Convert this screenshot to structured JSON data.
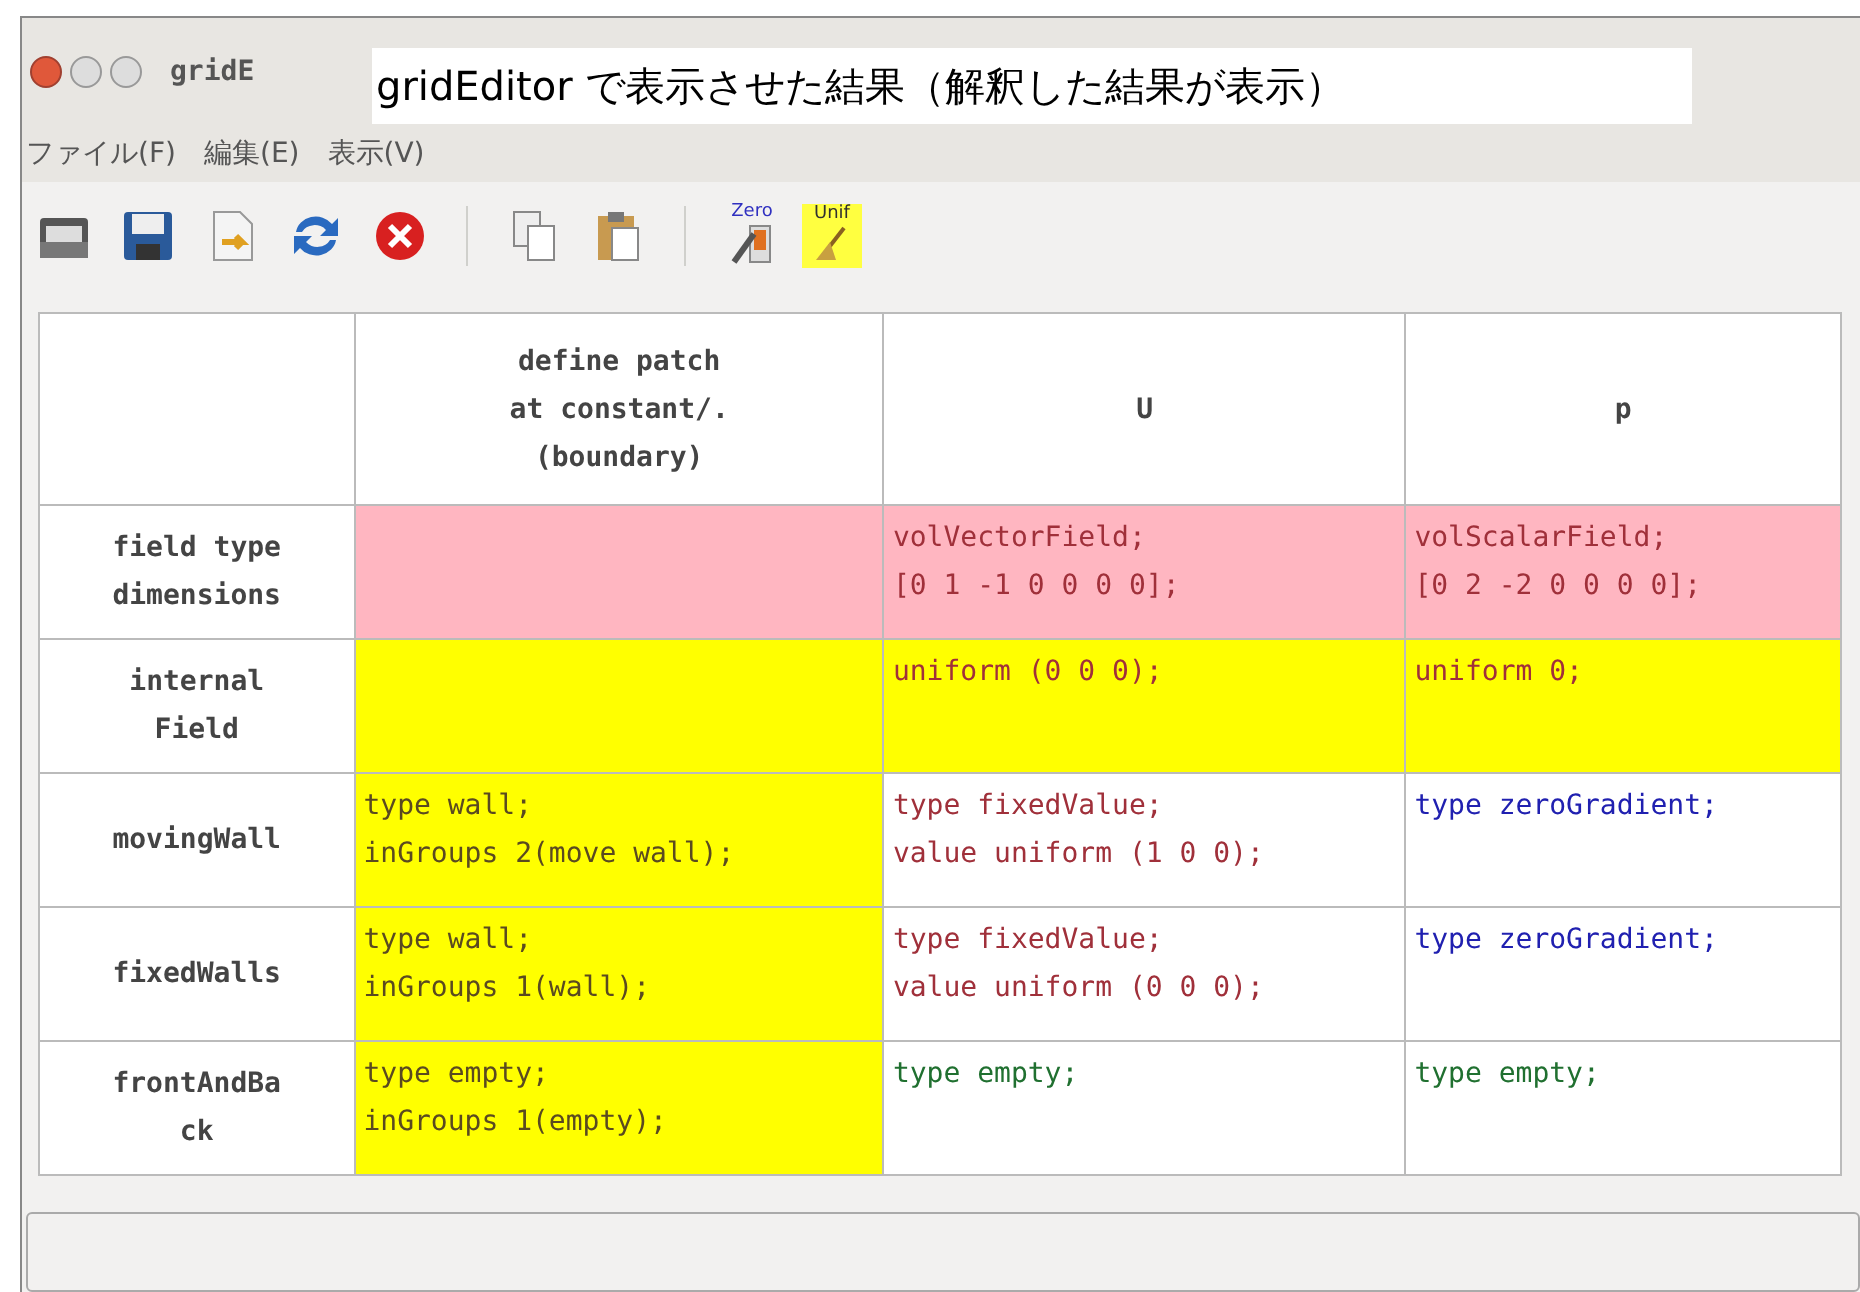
{
  "window": {
    "title": "gridE"
  },
  "caption": "gridEditor で表示させた結果（解釈した結果が表示）",
  "menu": [
    "ファイル(F)",
    "編集(E)",
    "表示(V)"
  ],
  "toolbar": [
    {
      "kind": "open"
    },
    {
      "kind": "save"
    },
    {
      "kind": "import"
    },
    {
      "kind": "refresh"
    },
    {
      "kind": "close"
    },
    {
      "kind": "separator"
    },
    {
      "kind": "copy"
    },
    {
      "kind": "paste"
    },
    {
      "kind": "separator"
    },
    {
      "kind": "zero",
      "label": "Zero"
    },
    {
      "kind": "unif",
      "label": "Unif"
    }
  ],
  "table": {
    "columns": [
      "",
      "define patch\nat constant/.\n(boundary)",
      "U",
      "p"
    ],
    "rows": [
      {
        "cells": [
          {
            "kind": "header",
            "lines": [
              "field type",
              "dimensions"
            ]
          },
          {
            "kind": "pink"
          },
          {
            "kind": "pink",
            "color": "#a0303a",
            "lines": [
              "volVectorField;",
              "[0 1 -1 0 0 0 0];"
            ]
          },
          {
            "kind": "pink",
            "color": "#a0303a",
            "lines": [
              "volScalarField;",
              "[0 2 -2 0 0 0 0];"
            ]
          }
        ]
      },
      {
        "cells": [
          {
            "kind": "header",
            "lines": [
              "internal",
              "Field"
            ]
          },
          {
            "kind": "yellow"
          },
          {
            "kind": "yellow",
            "color": "#a0303a",
            "lines": [
              "uniform (0 0 0);"
            ]
          },
          {
            "kind": "yellow",
            "color": "#a0303a",
            "lines": [
              "uniform 0;"
            ]
          }
        ]
      },
      {
        "cells": [
          {
            "kind": "header",
            "lines": [
              "movingWall"
            ]
          },
          {
            "kind": "yellow",
            "color": "#5a4a20",
            "lines": [
              "type wall;",
              "inGroups 2(move wall);"
            ]
          },
          {
            "kind": "plain",
            "color": "#a0303a",
            "lines": [
              "type fixedValue;",
              "value uniform (1 0 0);"
            ]
          },
          {
            "kind": "plain",
            "color": "#2020b0",
            "lines": [
              "type zeroGradient;"
            ]
          }
        ]
      },
      {
        "cells": [
          {
            "kind": "header",
            "lines": [
              "fixedWalls"
            ]
          },
          {
            "kind": "yellow",
            "color": "#5a4a20",
            "lines": [
              "type wall;",
              "inGroups 1(wall);"
            ]
          },
          {
            "kind": "plain",
            "color": "#a0303a",
            "lines": [
              "type fixedValue;",
              "value uniform (0 0 0);"
            ]
          },
          {
            "kind": "plain",
            "color": "#2020b0",
            "lines": [
              "type zeroGradient;"
            ]
          }
        ]
      },
      {
        "cells": [
          {
            "kind": "header",
            "lines": [
              "frontAndBa",
              "ck"
            ]
          },
          {
            "kind": "yellow",
            "color": "#5a4a20",
            "lines": [
              "type empty;",
              "inGroups 1(empty);"
            ]
          },
          {
            "kind": "plain",
            "color": "#207030",
            "lines": [
              "type empty;"
            ]
          },
          {
            "kind": "plain",
            "color": "#207030",
            "lines": [
              "type empty;"
            ]
          }
        ]
      }
    ]
  }
}
